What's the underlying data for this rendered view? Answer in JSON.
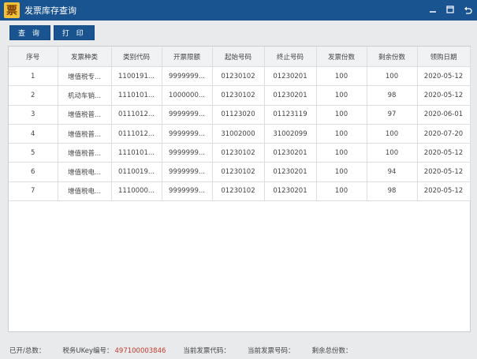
{
  "window": {
    "logo_char": "票",
    "title": "发票库存查询"
  },
  "toolbar": {
    "query_label": "查 询",
    "print_label": "打 印"
  },
  "table": {
    "columns": [
      "序号",
      "发票种类",
      "类别代码",
      "开票限额",
      "起始号码",
      "终止号码",
      "发票份数",
      "剩余份数",
      "领购日期"
    ],
    "rows": [
      [
        "1",
        "增值税专...",
        "1100191...",
        "9999999...",
        "01230102",
        "01230201",
        "100",
        "100",
        "2020-05-12"
      ],
      [
        "2",
        "机动车销...",
        "1110101...",
        "1000000...",
        "01230102",
        "01230201",
        "100",
        "98",
        "2020-05-12"
      ],
      [
        "3",
        "增值税普...",
        "0111012...",
        "9999999...",
        "01123020",
        "01123119",
        "100",
        "97",
        "2020-06-01"
      ],
      [
        "4",
        "增值税普...",
        "0111012...",
        "9999999...",
        "31002000",
        "31002099",
        "100",
        "100",
        "2020-07-20"
      ],
      [
        "5",
        "增值税普...",
        "1110101...",
        "9999999...",
        "01230102",
        "01230201",
        "100",
        "100",
        "2020-05-12"
      ],
      [
        "6",
        "增值税电...",
        "0110019...",
        "9999999...",
        "01230102",
        "01230201",
        "100",
        "94",
        "2020-05-12"
      ],
      [
        "7",
        "增值税电...",
        "1110000...",
        "9999999...",
        "01230102",
        "01230201",
        "100",
        "98",
        "2020-05-12"
      ]
    ]
  },
  "status": {
    "issued_label": "已开/总数：",
    "ukey_label": "税务UKey编号：",
    "ukey_value": "497100003846",
    "current_code_label": "当前发票代码：",
    "current_number_label": "当前发票号码：",
    "remaining_label": "剩余总份数："
  },
  "icons": {
    "minimize": "minimize-icon",
    "maximize": "maximize-icon",
    "back": "back-icon"
  }
}
